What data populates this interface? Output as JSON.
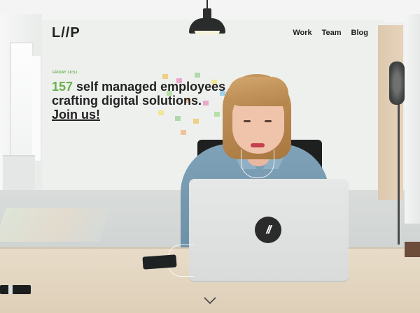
{
  "brand": {
    "logo_text": "L//P"
  },
  "nav": {
    "items": [
      {
        "label": "Work"
      },
      {
        "label": "Team"
      },
      {
        "label": "Blog"
      }
    ]
  },
  "hero": {
    "dateline": "FRIDAY 18:51",
    "employee_count": "157",
    "headline_rest": " self managed employees crafting digital solutions.",
    "cta": "Join us!",
    "laptop_logo": "//"
  },
  "icons": {
    "scroll_down": "chevron-down-icon"
  },
  "colors": {
    "accent": "#6ab04c",
    "text": "#222222",
    "laptop": "#e3e4e4",
    "logo_badge": "#2b2b2b"
  }
}
